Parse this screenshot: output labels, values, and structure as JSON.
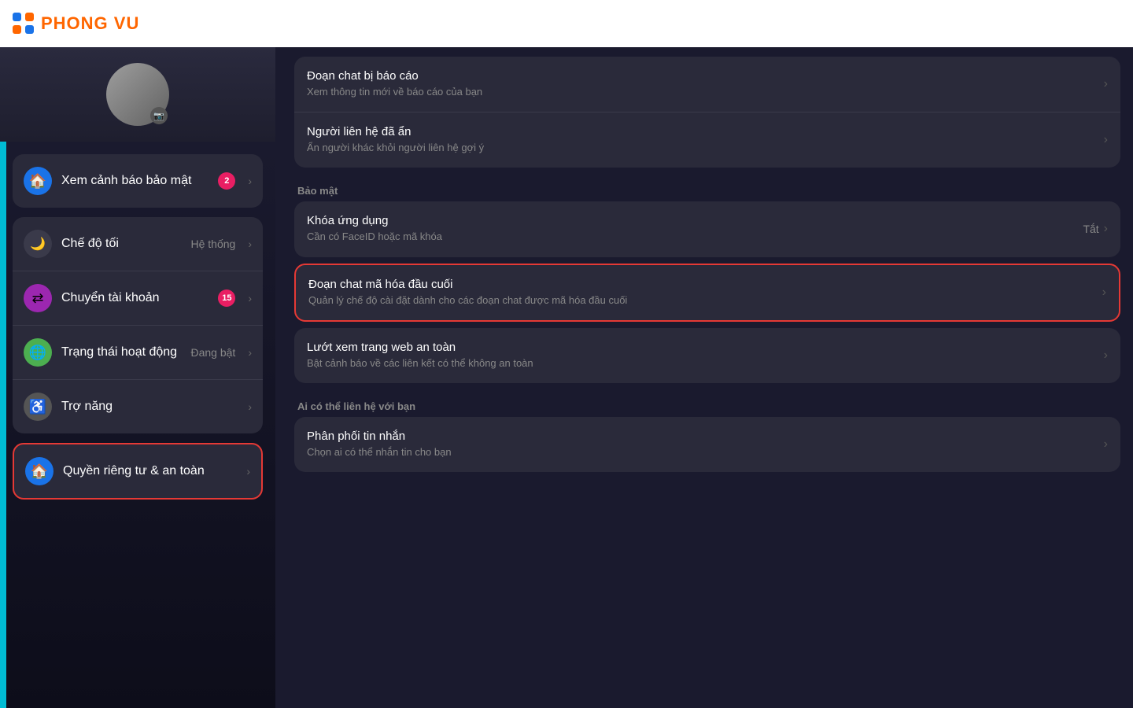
{
  "topbar": {
    "logo_text_black": "PHONG ",
    "logo_text_orange": "VU"
  },
  "left_panel": {
    "security_item": {
      "label": "Xem cảnh báo bảo mật",
      "badge": "2"
    },
    "dark_mode_item": {
      "label": "Chế độ tối",
      "value": "Hệ thống"
    },
    "transfer_item": {
      "label": "Chuyển tài khoản",
      "badge": "15"
    },
    "activity_item": {
      "label": "Trạng thái hoạt động",
      "value": "Đang bật"
    },
    "accessibility_item": {
      "label": "Trợ năng"
    },
    "privacy_item": {
      "label": "Quyền riêng tư & an toàn"
    }
  },
  "right_panel": {
    "items_top": [
      {
        "title": "Đoạn chat bị báo cáo",
        "desc": "Xem thông tin mới về báo cáo của bạn"
      },
      {
        "title": "Người liên hệ đã ẩn",
        "desc": "Ẩn người khác khỏi người liên hệ gợi ý"
      }
    ],
    "section_bao_mat": "Bảo mật",
    "bao_mat_items": [
      {
        "title": "Khóa ứng dụng",
        "desc": "Cần có FaceID hoặc mã khóa",
        "right_value": "Tắt",
        "highlighted": false
      },
      {
        "title": "Đoạn chat mã hóa đầu cuối",
        "desc": "Quản lý chế độ cài đặt dành cho các đoạn chat được mã hóa đầu cuối",
        "highlighted": true
      },
      {
        "title": "Lướt xem trang web an toàn",
        "desc": "Bật cảnh báo về các liên kết có thể không an toàn",
        "highlighted": false
      }
    ],
    "section_lien_he": "Ai có thể liên hệ với bạn",
    "lien_he_items": [
      {
        "title": "Phân phối tin nhắn",
        "desc": "Chọn ai có thể nhắn tin cho bạn"
      }
    ]
  }
}
